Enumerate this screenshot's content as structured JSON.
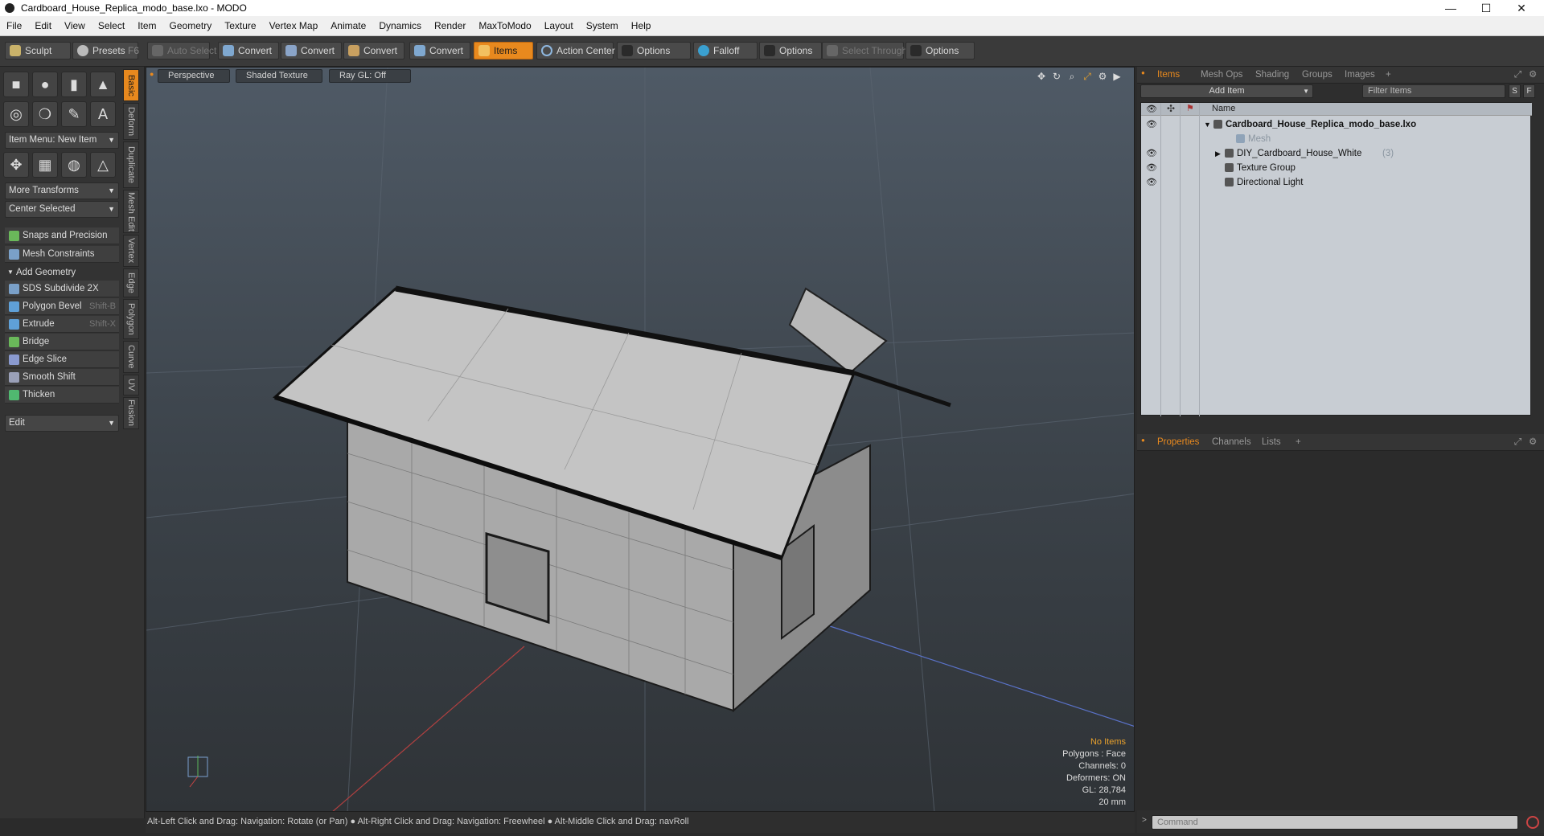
{
  "window": {
    "title": "Cardboard_House_Replica_modo_base.lxo - MODO",
    "minimize": "—",
    "maximize": "☐",
    "close": "✕"
  },
  "menu": [
    "File",
    "Edit",
    "View",
    "Select",
    "Item",
    "Geometry",
    "Texture",
    "Vertex Map",
    "Animate",
    "Dynamics",
    "Render",
    "MaxToModo",
    "Layout",
    "System",
    "Help"
  ],
  "toolbar": {
    "sculpt": "Sculpt",
    "presets": "Presets",
    "presets_key": "F6",
    "auto_select": "Auto Select",
    "convert": "Convert",
    "items": "Items",
    "action_center": "Action Center",
    "options": "Options",
    "falloff": "Falloff",
    "select_through": "Select Through"
  },
  "left": {
    "item_menu": "Item Menu: New Item",
    "more_transforms": "More Transforms",
    "center_selected": "Center Selected",
    "snaps": "Snaps and Precision",
    "constraints": "Mesh Constraints",
    "add_geometry": "Add Geometry",
    "tools": [
      {
        "label": "SDS Subdivide 2X",
        "shortcut": "",
        "color": "#7aa0c8"
      },
      {
        "label": "Polygon Bevel",
        "shortcut": "Shift-B",
        "color": "#5fa0d8"
      },
      {
        "label": "Extrude",
        "shortcut": "Shift-X",
        "color": "#5fa0d8"
      },
      {
        "label": "Bridge",
        "shortcut": "",
        "color": "#6ab85a"
      },
      {
        "label": "Edge Slice",
        "shortcut": "",
        "color": "#8a9ad0"
      },
      {
        "label": "Smooth Shift",
        "shortcut": "",
        "color": "#9aa0b8"
      },
      {
        "label": "Thicken",
        "shortcut": "",
        "color": "#50b870"
      }
    ],
    "edit": "Edit",
    "vtabs": [
      "Basic",
      "Deform",
      "Duplicate",
      "Mesh Edit",
      "Vertex",
      "Edge",
      "Polygon",
      "Curve",
      "UV",
      "Fusion"
    ]
  },
  "viewport": {
    "view": "Perspective",
    "shading": "Shaded Texture",
    "raygl": "Ray GL: Off",
    "info": {
      "items": "No Items",
      "polygons": "Polygons : Face",
      "channels": "Channels: 0",
      "deformers": "Deformers: ON",
      "gl": "GL: 28,784",
      "scale": "20 mm"
    }
  },
  "status": "Alt-Left Click and Drag: Navigation: Rotate (or Pan) ● Alt-Right Click and Drag: Navigation: Freewheel ● Alt-Middle Click and Drag: navRoll",
  "right": {
    "tabs": [
      "Items",
      "Mesh Ops",
      "Shading",
      "Groups",
      "Images"
    ],
    "add_item": "Add Item",
    "filter": "Filter Items",
    "s_btn": "S",
    "f_btn": "F",
    "col_name": "Name",
    "items": [
      {
        "label": "Cardboard_House_Replica_modo_base.lxo",
        "bold": true,
        "indent": 0,
        "count": ""
      },
      {
        "label": "Mesh",
        "dim": true,
        "indent": 2,
        "count": ""
      },
      {
        "label": "DIY_Cardboard_House_White",
        "indent": 1,
        "count": "(3)"
      },
      {
        "label": "Texture Group",
        "indent": 1,
        "count": ""
      },
      {
        "label": "Directional Light",
        "indent": 1,
        "count": ""
      }
    ],
    "lower_tabs": [
      "Properties",
      "Channels",
      "Lists"
    ],
    "command_placeholder": "Command"
  },
  "colors": {
    "accent": "#e8891e",
    "panel": "#333333",
    "viewport_top": "#4f5a66"
  }
}
